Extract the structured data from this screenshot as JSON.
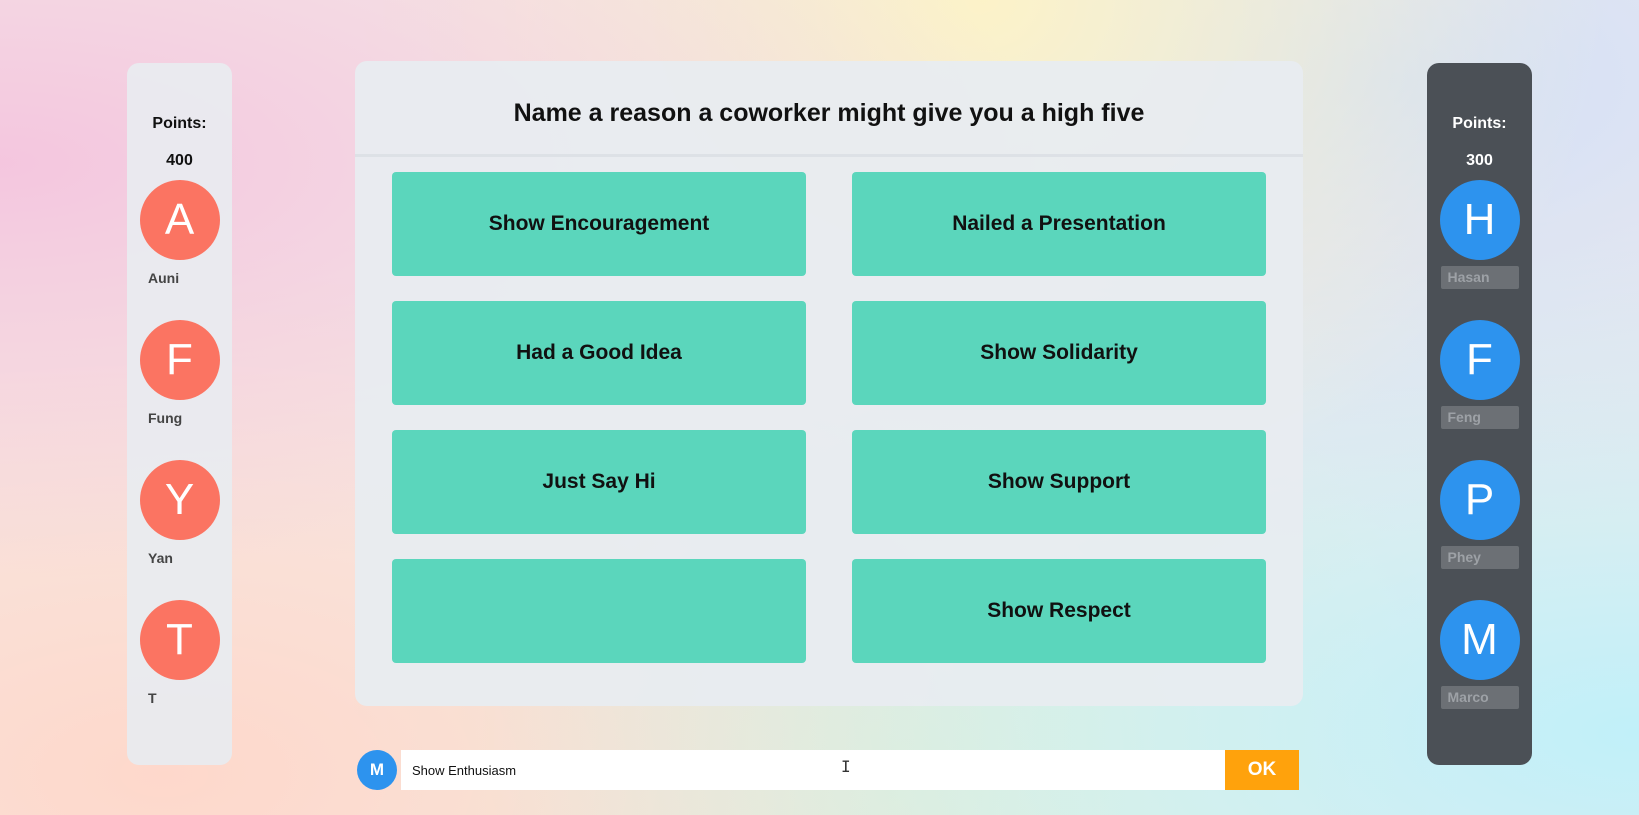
{
  "question": "Name a reason a coworker might give you a high five",
  "answers": [
    "Show Encouragement",
    "Nailed a Presentation",
    "Had a Good Idea",
    "Show Solidarity",
    "Just Say Hi",
    "Show Support",
    "",
    "Show Respect"
  ],
  "team_left": {
    "points_label": "Points:",
    "points": "400",
    "players": [
      {
        "initial": "A",
        "name": "Auni"
      },
      {
        "initial": "F",
        "name": "Fung"
      },
      {
        "initial": "Y",
        "name": "Yan"
      },
      {
        "initial": "T",
        "name": "T"
      }
    ]
  },
  "team_right": {
    "points_label": "Points:",
    "points": "300",
    "players": [
      {
        "initial": "H",
        "name": "Hasan"
      },
      {
        "initial": "F",
        "name": "Feng"
      },
      {
        "initial": "P",
        "name": "Phey"
      },
      {
        "initial": "M",
        "name": "Marco"
      }
    ]
  },
  "input": {
    "avatar_initial": "M",
    "value": "Show Enthusiasm",
    "ok_label": "OK"
  },
  "colors": {
    "left_team": "#fb7462",
    "right_team": "#2d93ee",
    "answer_tile": "#5bd6bc",
    "ok_button": "#ffa20c"
  }
}
